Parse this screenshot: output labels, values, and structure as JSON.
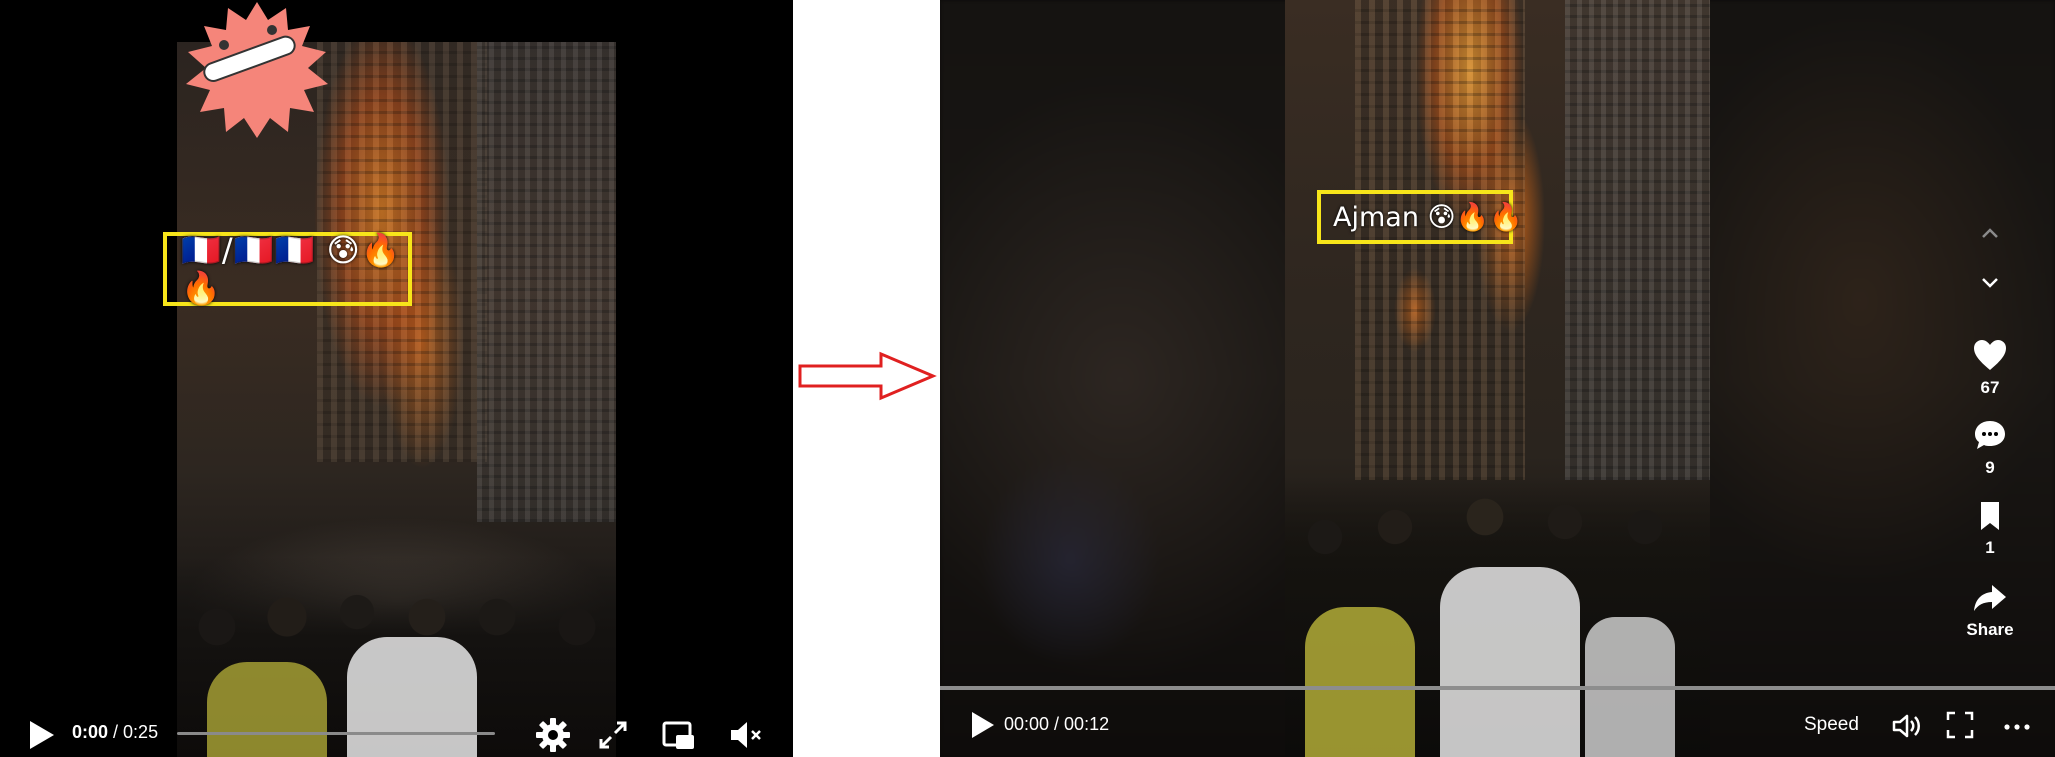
{
  "left_player": {
    "caption": "🇫🇷/🇫🇷🇫🇷 😰🔥🔥",
    "time_current": "0:00",
    "time_separator": " / ",
    "time_total": "0:25",
    "icons": [
      "play-icon",
      "gear-icon",
      "expand-icon",
      "picture-in-picture-icon",
      "mute-icon"
    ]
  },
  "arrow": {
    "color": "#e02020"
  },
  "right_player": {
    "caption": "Ajman 😰🔥🔥",
    "time": "00:00 / 00:12",
    "speed_label": "Speed",
    "likes": "67",
    "comments": "9",
    "saves": "1",
    "share_label": "Share",
    "icons": [
      "chevron-up-icon",
      "chevron-down-icon",
      "heart-icon",
      "comment-icon",
      "bookmark-icon",
      "share-icon",
      "play-icon",
      "volume-icon",
      "fullscreen-icon",
      "more-icon"
    ]
  },
  "colors": {
    "highlight_box": "#f7e51a",
    "sticker": "#f5857a"
  }
}
